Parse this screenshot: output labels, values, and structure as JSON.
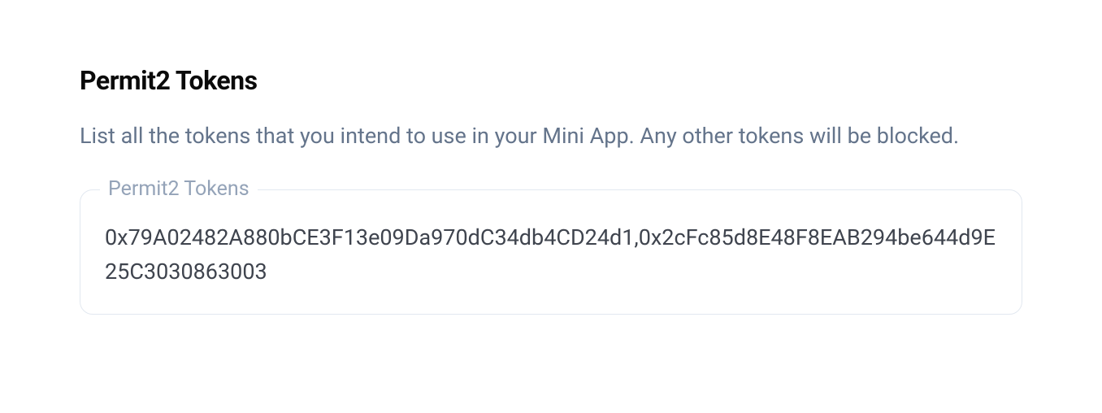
{
  "section": {
    "title": "Permit2 Tokens",
    "description": "List all the tokens that you intend to use in your Mini App. Any other tokens will be blocked."
  },
  "field": {
    "label": "Permit2 Tokens",
    "value": "0x79A02482A880bCE3F13e09Da970dC34db4CD24d1,0x2cFc85d8E48F8EAB294be644d9E25C3030863003"
  }
}
